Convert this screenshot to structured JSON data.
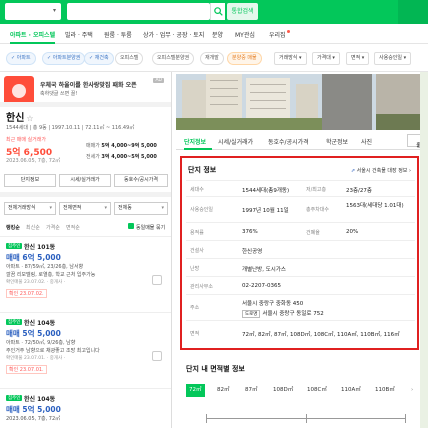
{
  "search": {
    "type_select": "",
    "query": "",
    "button_label": "통합검색"
  },
  "nav": {
    "items": [
      {
        "label": "아파트 · 오피스텔",
        "active": true
      },
      {
        "label": "빌라 · 주택"
      },
      {
        "label": "원룸 · 투룸"
      },
      {
        "label": "상가 · 업무 · 공장 · 토지"
      },
      {
        "label": "분양"
      },
      {
        "label": "MY관심"
      },
      {
        "label": "우리집"
      }
    ]
  },
  "filters": {
    "chips": [
      "아파트",
      "아파트분양권",
      "재건축",
      "오피스텔",
      "오피스텔분양권",
      "재개발",
      "분양중 매물"
    ],
    "dropdowns": [
      "거래방식",
      "가격대",
      "면적",
      "사용승인일"
    ]
  },
  "ad": {
    "tag": "AD",
    "title": "우체국 하울이를 한사랑맞집 패화 오픈",
    "subtitle": "축하댓글 쓰면 꿀!"
  },
  "complex": {
    "name": "한신",
    "meta": "1544세대 | 총 9동 | 1997.10.11 | 72.11㎡ ~ 116.49㎡",
    "recent_label": "최근 매매 실거래가",
    "recent_price": "5억 6,500",
    "recent_date": "2023.06.05, 7층, 72㎡",
    "sale_label": "매매가",
    "sale_range": "5억 4,000~9억 5,000",
    "jeonse_label": "전세가",
    "jeonse_range": "3억 4,000~5억 5,000",
    "buttons": [
      "단지정보",
      "시세/실거래가",
      "동호수/공시가격"
    ]
  },
  "list_filters": {
    "selects": [
      "전체거래방식",
      "전체면적",
      "전체동"
    ]
  },
  "sort": {
    "options": [
      "랭킹순",
      "최신순",
      "가격순",
      "면적순"
    ],
    "group_label": "동일매물 묶기"
  },
  "listings": [
    {
      "badge": "집주인",
      "name": "한신 101동",
      "price": "매매 6억 5,000",
      "desc1": "아파트 · 87/59㎡, 23/26층, 남서향",
      "desc2": "깔끔 리모델링, 로열층, 학교 근처 입주가능",
      "desc3": "확인매물 23.07.02. · 중개사 ·",
      "confirm": "확인 23.07.02."
    },
    {
      "badge": "집주인",
      "name": "한신 104동",
      "price": "매매 5억 5,000",
      "desc1": "아파트 · 72/50㎡, 9/26층, 남향",
      "desc2": "주인거주 남향으로 채광좋고 조망 최고입니다",
      "desc3": "확인매물 23.07.01. · 중개사 ·",
      "confirm": "확인 23.07.01."
    },
    {
      "badge": "집주인",
      "name": "한신 104동",
      "price": "매매 5억 5,000",
      "desc1": "2023.06.05, 7층, 72㎡",
      "desc2": "",
      "desc3": "",
      "confirm": ""
    }
  ],
  "detail_tabs": {
    "items": [
      "단지정보",
      "시세/실거래가",
      "동호수/공시가격",
      "학군정보",
      "사진"
    ],
    "share_label": "공유"
  },
  "info": {
    "title": "단지 정보",
    "link_label": "서울시 건축물 대장 정보",
    "rows": [
      {
        "k": "세대수",
        "v": "1544세대(총9개동)",
        "k2": "저/최고층",
        "v2": "23층/27층"
      },
      {
        "k": "사용승인일",
        "v": "1997년 10월 11일",
        "k2": "총주차대수",
        "v2": "1563대(세대당 1.01대)"
      },
      {
        "k": "용적률",
        "v": "376%",
        "k2": "건폐율",
        "v2": "20%"
      },
      {
        "k": "건설사",
        "v": "한신공영"
      },
      {
        "k": "난방",
        "v": "개별난방, 도시가스"
      },
      {
        "k": "관리사무소",
        "v": "02-2207-0365"
      },
      {
        "k": "주소",
        "v": "서울시 중랑구 중화동 450",
        "v_b_label": "도로명",
        "v_b": "서울시 중랑구 동일로 752"
      },
      {
        "k": "면적",
        "v": "72㎡, 82㎡, 87㎡, 108D㎡, 108C㎡, 110A㎡, 110B㎡, 116㎡"
      }
    ]
  },
  "area": {
    "title": "단지 내 면적별 정보",
    "tabs": [
      "72㎡",
      "82㎡",
      "87㎡",
      "108D㎡",
      "108C㎡",
      "110A㎡",
      "110B㎡"
    ]
  }
}
